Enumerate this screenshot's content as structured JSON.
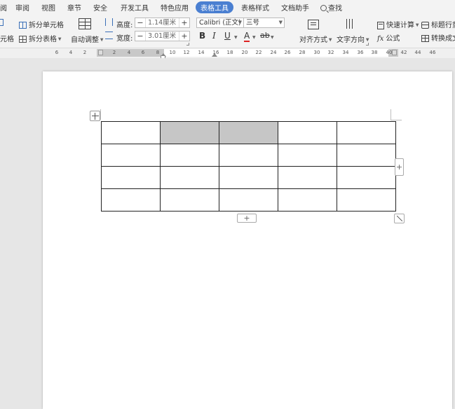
{
  "menubar": {
    "items": [
      {
        "label": "阅"
      },
      {
        "label": "审阅"
      },
      {
        "label": "视图"
      },
      {
        "label": "章节"
      },
      {
        "label": "安全"
      },
      {
        "label": "开发工具"
      },
      {
        "label": "特色应用"
      },
      {
        "label": "表格工具"
      },
      {
        "label": "表格样式"
      },
      {
        "label": "文档助手"
      }
    ],
    "active": "表格工具",
    "search_label": "查找"
  },
  "ribbon": {
    "merge_cells_label": "元格",
    "split_cells_label": "拆分单元格",
    "split_table_label": "拆分表格",
    "auto_adjust_label": "自动调整",
    "height_label": "高度:",
    "height_value": "1.14厘米",
    "width_label": "宽度:",
    "width_value": "3.01厘米",
    "font_name": "Calibri (正文)",
    "font_size": "三号",
    "bold": "B",
    "italic": "I",
    "underline": "U",
    "font_color": "A",
    "highlight": "ab",
    "align_label": "对齐方式",
    "text_dir_label": "文字方向",
    "quick_calc_label": "快速计算",
    "formula_label": "公式",
    "formula_icon": "fx",
    "title_row_label": "标题行重",
    "convert_label": "转换成文",
    "minus": "−",
    "plus": "+"
  },
  "ruler": {
    "ticks": [
      "6",
      "4",
      "2",
      "2",
      "4",
      "6",
      "8",
      "10",
      "12",
      "14",
      "16",
      "18",
      "20",
      "22",
      "24",
      "26",
      "28",
      "30",
      "32",
      "34",
      "36",
      "38",
      "40",
      "42",
      "44",
      "46"
    ]
  },
  "table": {
    "rows": 4,
    "cols": 5,
    "selected_cells": [
      [
        0,
        1
      ],
      [
        0,
        2
      ]
    ]
  },
  "controls": {
    "add_row_symbol": "+",
    "add_col_symbol": "+"
  },
  "colors": {
    "accent": "#4a7fd1",
    "selection": "#c6c6c6",
    "page": "#ffffff",
    "background": "#e6e6e6"
  }
}
